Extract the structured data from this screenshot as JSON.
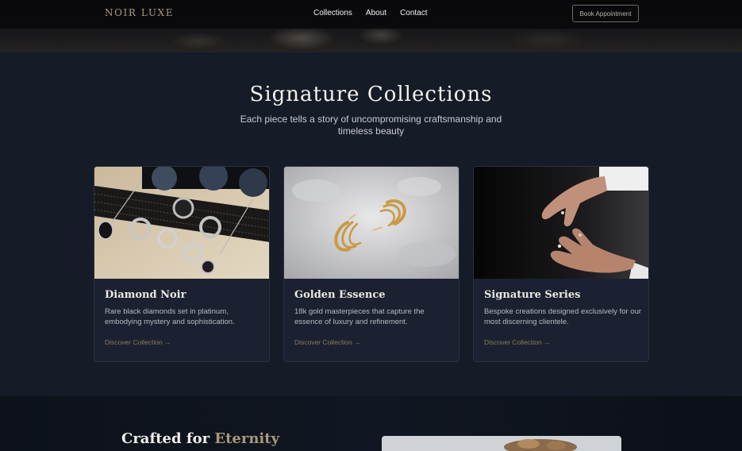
{
  "header": {
    "logo": "NOIR LUXE",
    "nav_links": [
      "Collections",
      "About",
      "Contact"
    ],
    "cta_label": "Book Appointment"
  },
  "collections": {
    "title": "Signature Collections",
    "subtitle": "Each piece tells a story of uncompromising craftsmanship and timeless beauty",
    "cards": [
      {
        "title": "Diamond Noir",
        "description": "Rare black diamonds set in platinum, embodying mystery and sophistication.",
        "link_label": "Discover Collection →"
      },
      {
        "title": "Golden Essence",
        "description": "18k gold masterpieces that capture the essence of luxury and refinement.",
        "link_label": "Discover Collection →"
      },
      {
        "title": "Signature Series",
        "description": "Bespoke creations designed exclusively for our most discerning clientele.",
        "link_label": "Discover Collection →"
      }
    ]
  },
  "crafted": {
    "title_prefix": "Crafted for",
    "title_accent": "Eternity"
  },
  "colors": {
    "background": "#151b27",
    "card_background": "#1b2130",
    "gold_accent": "#a9987a",
    "link": "#8d7b5f"
  }
}
